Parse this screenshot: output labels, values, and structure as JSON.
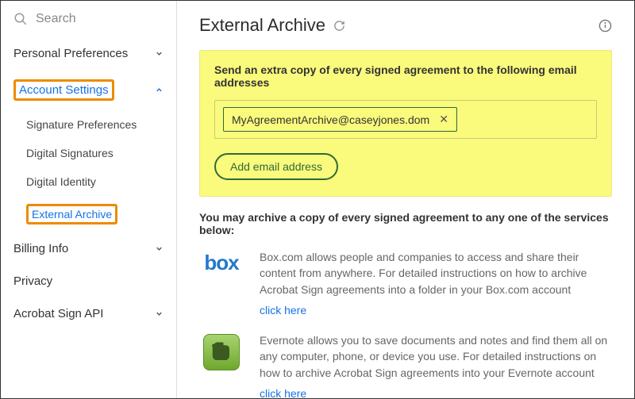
{
  "sidebar": {
    "search_placeholder": "Search",
    "sections": {
      "personal": {
        "label": "Personal Preferences"
      },
      "account": {
        "label": "Account Settings",
        "items": [
          {
            "label": "Signature Preferences"
          },
          {
            "label": "Digital Signatures"
          },
          {
            "label": "Digital Identity"
          },
          {
            "label": "External Archive"
          }
        ]
      },
      "billing": {
        "label": "Billing Info"
      },
      "privacy": {
        "label": "Privacy"
      },
      "api": {
        "label": "Acrobat Sign API"
      }
    }
  },
  "main": {
    "title": "External Archive",
    "panel_title": "Send an extra copy of every signed agreement to the following email addresses",
    "email_chip": "MyAgreementArchive@caseyjones.dom",
    "add_email_label": "Add email address",
    "services_intro": "You may archive a copy of every signed agreement to any one of the services below:",
    "services": [
      {
        "name": "box",
        "desc": "Box.com allows people and companies to access and share their content from anywhere. For detailed instructions on how to archive Acrobat Sign agreements into a folder in your Box.com account",
        "link": "click here"
      },
      {
        "name": "evernote",
        "desc": "Evernote allows you to save documents and notes and find them all on any computer, phone, or device you use. For detailed instructions on how to archive Acrobat Sign agreements into your Evernote account",
        "link": "click here"
      }
    ]
  }
}
